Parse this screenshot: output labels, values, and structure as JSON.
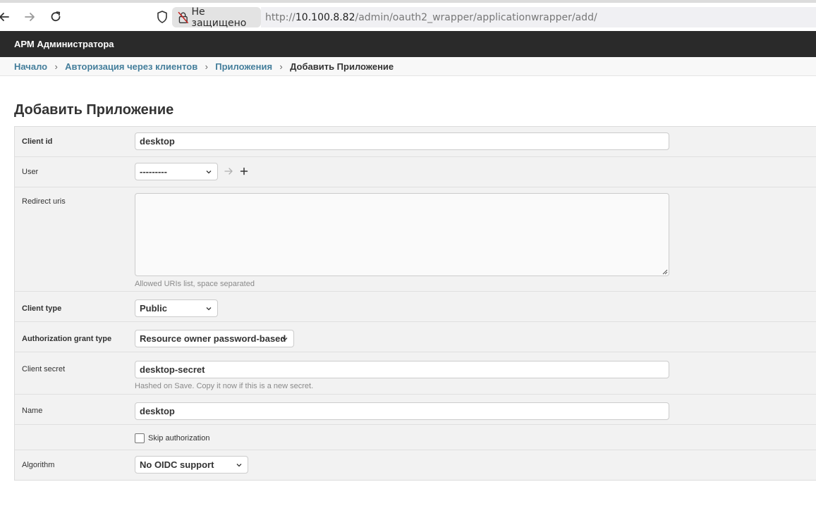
{
  "browser": {
    "security_label": "Не защищено",
    "url_scheme": "http://",
    "url_host": "10.100.8.82",
    "url_path": "/admin/oauth2_wrapper/applicationwrapper/add/"
  },
  "header": {
    "branding": "АРМ Администратора"
  },
  "breadcrumbs": {
    "home": "Начало",
    "app": "Авторизация через клиентов",
    "model": "Приложения",
    "current": "Добавить Приложение",
    "separator": "›"
  },
  "page": {
    "title": "Добавить Приложение"
  },
  "form": {
    "client_id": {
      "label": "Client id",
      "value": "desktop"
    },
    "user": {
      "label": "User",
      "selected": "---------"
    },
    "redirect_uris": {
      "label": "Redirect uris",
      "value": "",
      "help": "Allowed URIs list, space separated"
    },
    "client_type": {
      "label": "Client type",
      "selected": "Public"
    },
    "grant_type": {
      "label": "Authorization grant type",
      "selected": "Resource owner password-based"
    },
    "client_secret": {
      "label": "Client secret",
      "value": "desktop-secret",
      "help": "Hashed on Save. Copy it now if this is a new secret."
    },
    "name": {
      "label": "Name",
      "value": "desktop"
    },
    "skip_authorization": {
      "label": "Skip authorization",
      "checked": false
    },
    "algorithm": {
      "label": "Algorithm",
      "selected": "No OIDC support"
    }
  },
  "colors": {
    "header_bg": "#2a2a2a",
    "link": "#447e9b",
    "fieldset_bg": "#f2f2f2"
  }
}
